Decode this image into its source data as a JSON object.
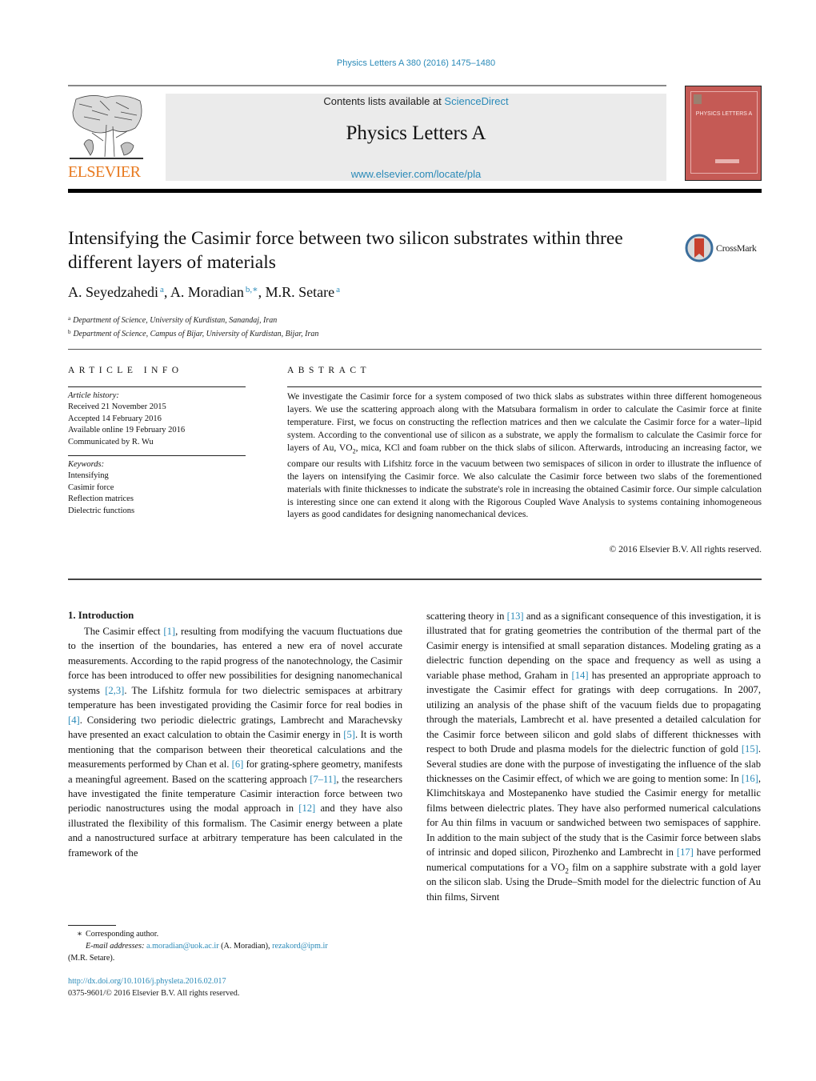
{
  "header": {
    "journal_reference": "Physics Letters A 380 (2016) 1475–1480",
    "contents_prefix": "Contents lists available at ",
    "contents_link": "ScienceDirect",
    "journal_name": "Physics Letters A",
    "journal_url": "www.elsevier.com/locate/pla",
    "publisher_logo_text": "ELSEVIER",
    "cover_title": "PHYSICS LETTERS A"
  },
  "article": {
    "title": "Intensifying the Casimir force between two silicon substrates within three different layers of materials",
    "crossmark_label": "CrossMark",
    "authors": [
      {
        "name": "A. Seyedzahedi",
        "sup": "a"
      },
      {
        "name": "A. Moradian",
        "sup": "b,∗"
      },
      {
        "name": "M.R. Setare",
        "sup": "a"
      }
    ],
    "affiliations": [
      {
        "mark": "a",
        "text": "Department of Science, University of Kurdistan, Sanandaj, Iran"
      },
      {
        "mark": "b",
        "text": "Department of Science, Campus of Bijar, University of Kurdistan, Bijar, Iran"
      }
    ]
  },
  "article_info": {
    "heading": "ARTICLE INFO",
    "history_label": "Article history:",
    "history": [
      "Received 21 November 2015",
      "Accepted 14 February 2016",
      "Available online 19 February 2016",
      "Communicated by R. Wu"
    ],
    "keywords_label": "Keywords:",
    "keywords": [
      "Intensifying",
      "Casimir force",
      "Reflection matrices",
      "Dielectric functions"
    ]
  },
  "abstract": {
    "heading": "ABSTRACT",
    "text_part1": "We investigate the Casimir force for a system composed of two thick slabs as substrates within three different homogeneous layers. We use the scattering approach along with the Matsubara formalism in order to calculate the Casimir force at finite temperature. First, we focus on constructing the reflection matrices and then we calculate the Casimir force for a water–lipid system. According to the conventional use of silicon as a substrate, we apply the formalism to calculate the Casimir force for layers of Au, VO",
    "text_sub": "2",
    "text_part2": ", mica, KCl and foam rubber on the thick slabs of silicon. Afterwards, introducing an increasing factor, we compare our results with Lifshitz force in the vacuum between two semispaces of silicon in order to illustrate the influence of the layers on intensifying the Casimir force. We also calculate the Casimir force between two slabs of the forementioned materials with finite thicknesses to indicate the substrate's role in increasing the obtained Casimir force. Our simple calculation is interesting since one can extend it along with the Rigorous Coupled Wave Analysis to systems containing inhomogeneous layers as good candidates for designing nanomechanical devices.",
    "copyright": "© 2016 Elsevier B.V. All rights reserved."
  },
  "body": {
    "section_heading": "1. Introduction",
    "left": [
      {
        "t": "The Casimir effect "
      },
      {
        "ref": "[1]"
      },
      {
        "t": ", resulting from modifying the vacuum fluctuations due to the insertion of the boundaries, has entered a new era of novel accurate measurements. According to the rapid progress of the nanotechnology, the Casimir force has been introduced to offer new possibilities for designing nanomechanical systems "
      },
      {
        "ref": "[2,3]"
      },
      {
        "t": ". The Lifshitz formula for two dielectric semispaces at arbitrary temperature has been investigated providing the Casimir force for real bodies in "
      },
      {
        "ref": "[4]"
      },
      {
        "t": ". Considering two periodic dielectric gratings, Lambrecht and Marachevsky have presented an exact calculation to obtain the Casimir energy in "
      },
      {
        "ref": "[5]"
      },
      {
        "t": ". It is worth mentioning that the comparison between their theoretical calculations and the measurements performed by Chan et al. "
      },
      {
        "ref": "[6]"
      },
      {
        "t": " for grating-sphere geometry, manifests a meaningful agreement. Based on the scattering approach "
      },
      {
        "ref": "[7–11]"
      },
      {
        "t": ", the researchers have investigated the finite temperature Casimir interaction force between two periodic nanostructures using the modal approach in "
      },
      {
        "ref": "[12]"
      },
      {
        "t": " and they have also illustrated the flexibility of this formalism. The Casimir energy between a plate and a nanostructured surface at arbitrary temperature has been calculated in the framework of the"
      }
    ],
    "right": [
      {
        "t": "scattering theory in "
      },
      {
        "ref": "[13]"
      },
      {
        "t": " and as a significant consequence of this investigation, it is illustrated that for grating geometries the contribution of the thermal part of the Casimir energy is intensified at small separation distances. Modeling grating as a dielectric function depending on the space and frequency as well as using a variable phase method, Graham in "
      },
      {
        "ref": "[14]"
      },
      {
        "t": " has presented an appropriate approach to investigate the Casimir effect for gratings with deep corrugations. In 2007, utilizing an analysis of the phase shift of the vacuum fields due to propagating through the materials, Lambrecht et al. have presented a detailed calculation for the Casimir force between silicon and gold slabs of different thicknesses with respect to both Drude and plasma models for the dielectric function of gold "
      },
      {
        "ref": "[15]"
      },
      {
        "t": ". Several studies are done with the purpose of investigating the influence of the slab thicknesses on the Casimir effect, of which we are going to mention some: In "
      },
      {
        "ref": "[16]"
      },
      {
        "t": ", Klimchitskaya and Mostepanenko have studied the Casimir energy for metallic films between dielectric plates. They have also performed numerical calculations for Au thin films in vacuum or sandwiched between two semispaces of sapphire. In addition to the main subject of the study that is the Casimir force between slabs of intrinsic and doped silicon, Pirozhenko and Lambrecht in "
      },
      {
        "ref": "[17]"
      },
      {
        "t": " have performed numerical computations for a VO"
      },
      {
        "sub": "2"
      },
      {
        "t": " film on a sapphire substrate with a gold layer on the silicon slab. Using the Drude–Smith model for the dielectric function of Au thin films, Sirvent"
      }
    ]
  },
  "footnotes": {
    "star": "∗",
    "corresponding": "Corresponding author.",
    "email_label": "E-mail addresses:",
    "email1": "a.moradian@uok.ac.ir",
    "email1_owner": " (A. Moradian), ",
    "email2": "rezakord@ipm.ir",
    "email2_owner": "(M.R. Setare).",
    "doi": "http://dx.doi.org/10.1016/j.physleta.2016.02.017",
    "issn_line": "0375-9601/© 2016 Elsevier B.V. All rights reserved."
  },
  "colors": {
    "link": "#2a8ab8",
    "elsevier_orange": "#e87a20",
    "cover_red": "#c55a55",
    "masthead_gray": "#ebebeb"
  }
}
